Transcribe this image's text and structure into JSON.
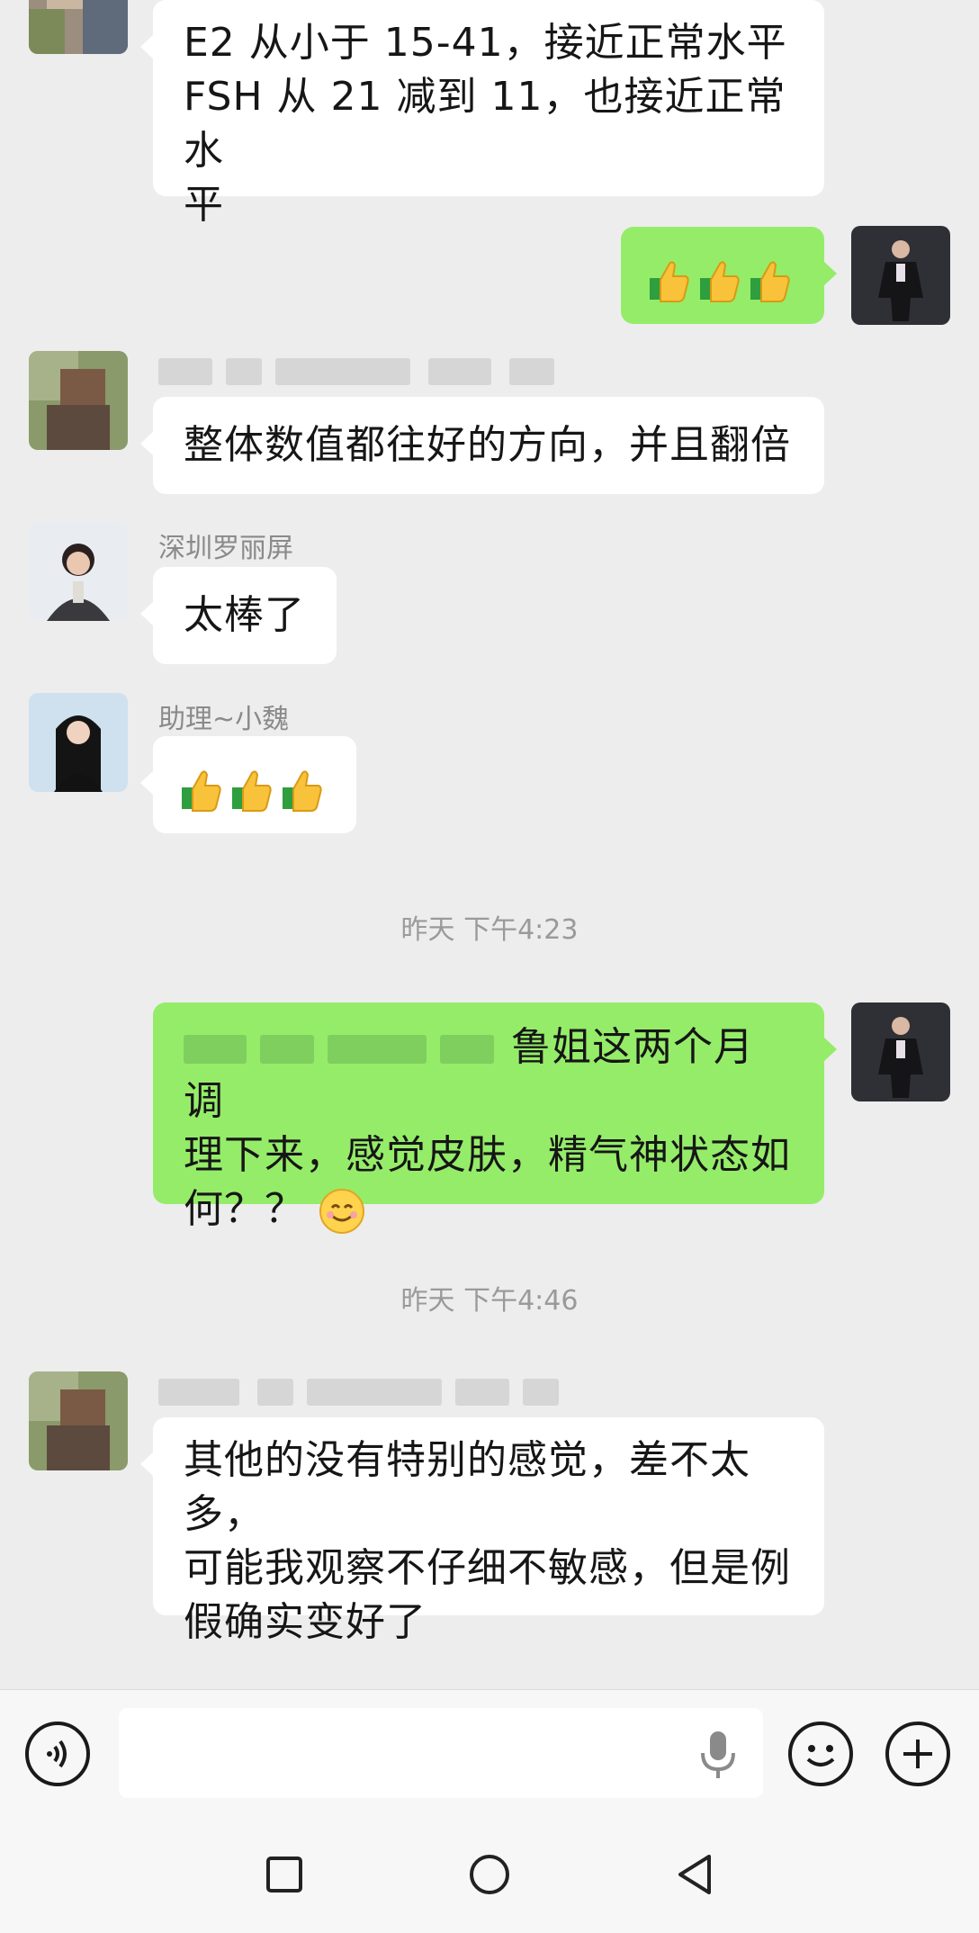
{
  "messages": [
    {
      "sender_name": "",
      "text_line1": "E2 从小于 15-41，接近正常水平",
      "text_line2": "FSH 从 21 减到 11，也接近正常水",
      "text_line3": "平"
    },
    {
      "reaction": "thumbs-up x3"
    },
    {
      "text": "整体数值都往好的方向，并且翻倍"
    },
    {
      "sender_name": "深圳罗丽屏",
      "text": "太棒了"
    },
    {
      "sender_name": "助理~小魏",
      "reaction": "thumbs-up x3"
    },
    {
      "text_line1": "鲁姐这两个月调",
      "text_line2": "理下来，感觉皮肤，精气神状态如",
      "text_line3": "何？？"
    },
    {
      "text_line1": "其他的没有特别的感觉，差不太多，",
      "text_line2": "可能我观察不仔细不敏感，但是例",
      "text_line3": "假确实变好了"
    }
  ],
  "timestamps": [
    "昨天 下午4:23",
    "昨天 下午4:46"
  ],
  "input": {
    "value": "",
    "placeholder": ""
  },
  "icons": [
    "voice-icon",
    "mic-icon",
    "emoji-icon",
    "plus-icon",
    "recent-apps-icon",
    "home-icon",
    "back-icon"
  ],
  "colors": {
    "outgoing_bubble": "#95ec69",
    "incoming_bubble": "#ffffff",
    "background": "#ededed"
  }
}
